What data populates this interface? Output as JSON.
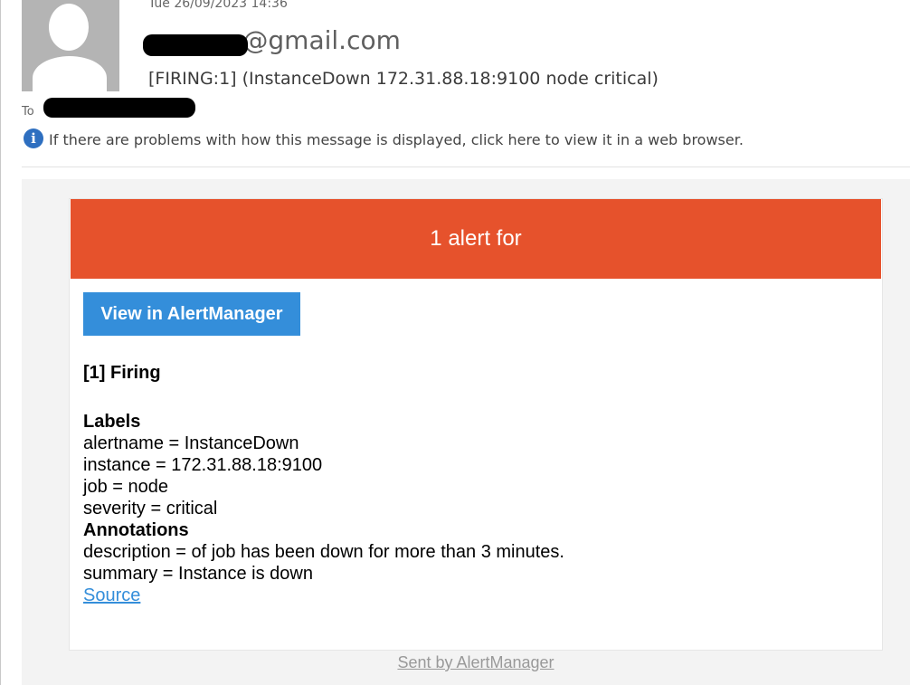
{
  "email": {
    "date": "Tue 26/09/2023 14:36",
    "sender_suffix": "@gmail.com",
    "subject": "[FIRING:1]  (InstanceDown 172.31.88.18:9100 node critical)",
    "to_label": "To",
    "info_text": "If there are problems with how this message is displayed, click here to view it in a web browser.",
    "info_icon_glyph": "i"
  },
  "alert": {
    "banner": "1 alert for",
    "view_button": "View in AlertManager",
    "firing_title": "[1] Firing",
    "labels_title": "Labels",
    "labels": [
      "alertname = InstanceDown",
      "instance = 172.31.88.18:9100",
      "job = node",
      "severity = critical"
    ],
    "annotations_title": "Annotations",
    "annotations": [
      "description = of job has been down for more than 3 minutes.",
      "summary = Instance is down"
    ],
    "source_link": "Source",
    "footer": "Sent by AlertManager"
  },
  "colors": {
    "banner": "#e6522c",
    "button": "#348eda",
    "link": "#348eda",
    "info_icon": "#2e6fc0"
  }
}
